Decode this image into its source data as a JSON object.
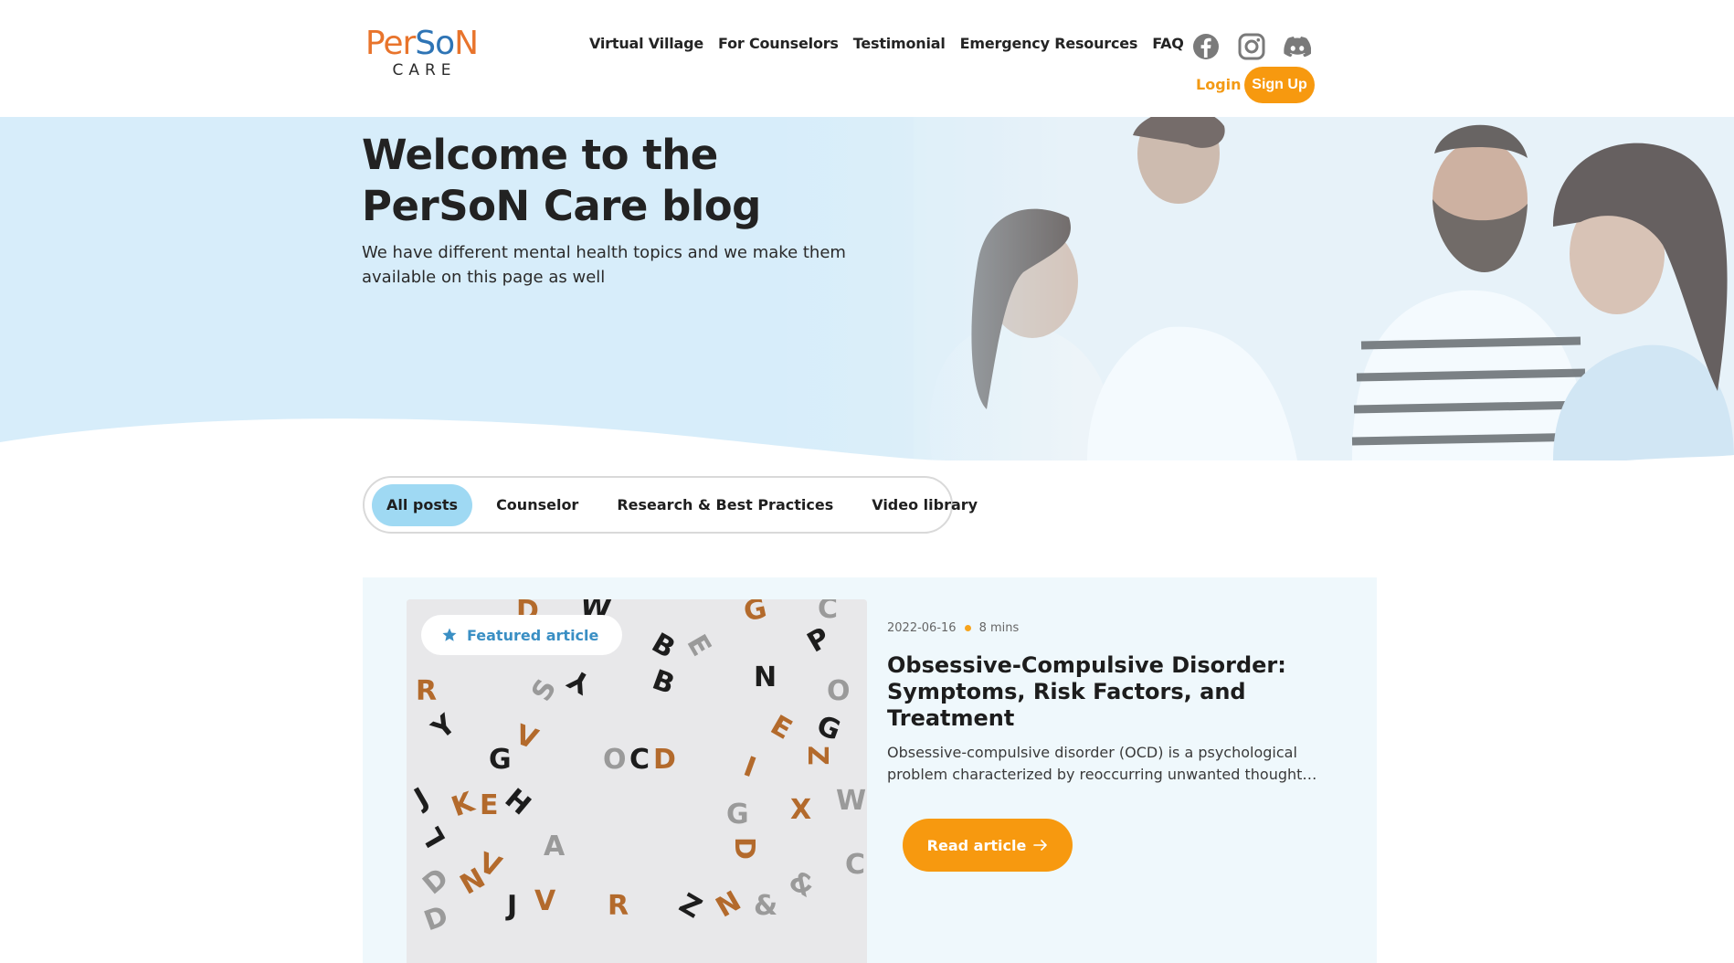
{
  "logo": {
    "top_part1": "Per",
    "top_part2": "So",
    "top_part3": "N",
    "bottom": "CARE"
  },
  "nav": {
    "items": [
      {
        "label": "Virtual Village"
      },
      {
        "label": "For Counselors"
      },
      {
        "label": "Testimonial"
      },
      {
        "label": "Emergency Resources"
      },
      {
        "label": "FAQ"
      }
    ]
  },
  "socials": [
    {
      "icon": "facebook-icon"
    },
    {
      "icon": "instagram-icon"
    },
    {
      "icon": "discord-icon"
    }
  ],
  "auth": {
    "login_label": "Login",
    "signup_label": "Sign Up"
  },
  "hero": {
    "title_line1": "Welcome to the",
    "title_line2": "PerSoN Care blog",
    "subtitle": "We have different mental health topics and we make them available on this page as well"
  },
  "tabs": [
    {
      "label": "All posts",
      "active": true
    },
    {
      "label": "Counselor",
      "active": false
    },
    {
      "label": "Research & Best Practices",
      "active": false
    },
    {
      "label": "Video library",
      "active": false
    }
  ],
  "featured": {
    "badge": "Featured article",
    "badge_icon": "star-icon",
    "date": "2022-06-16",
    "read_time": "8 mins",
    "title": "Obsessive-Compulsive Disorder: Symptoms, Risk Factors, and Treatment",
    "excerpt": "Obsessive-compulsive disorder (OCD) is a psychological problem characterized by reoccurring unwanted thought…",
    "button_label": "Read article",
    "button_icon": "arrow-right-icon",
    "image_text": "OCD"
  },
  "colors": {
    "accent_orange": "#f7990f",
    "hero_bg": "#d7eefa",
    "tab_active": "#9fd9f3",
    "card_bg": "#eff8fc",
    "badge_blue": "#3a8fc4"
  }
}
